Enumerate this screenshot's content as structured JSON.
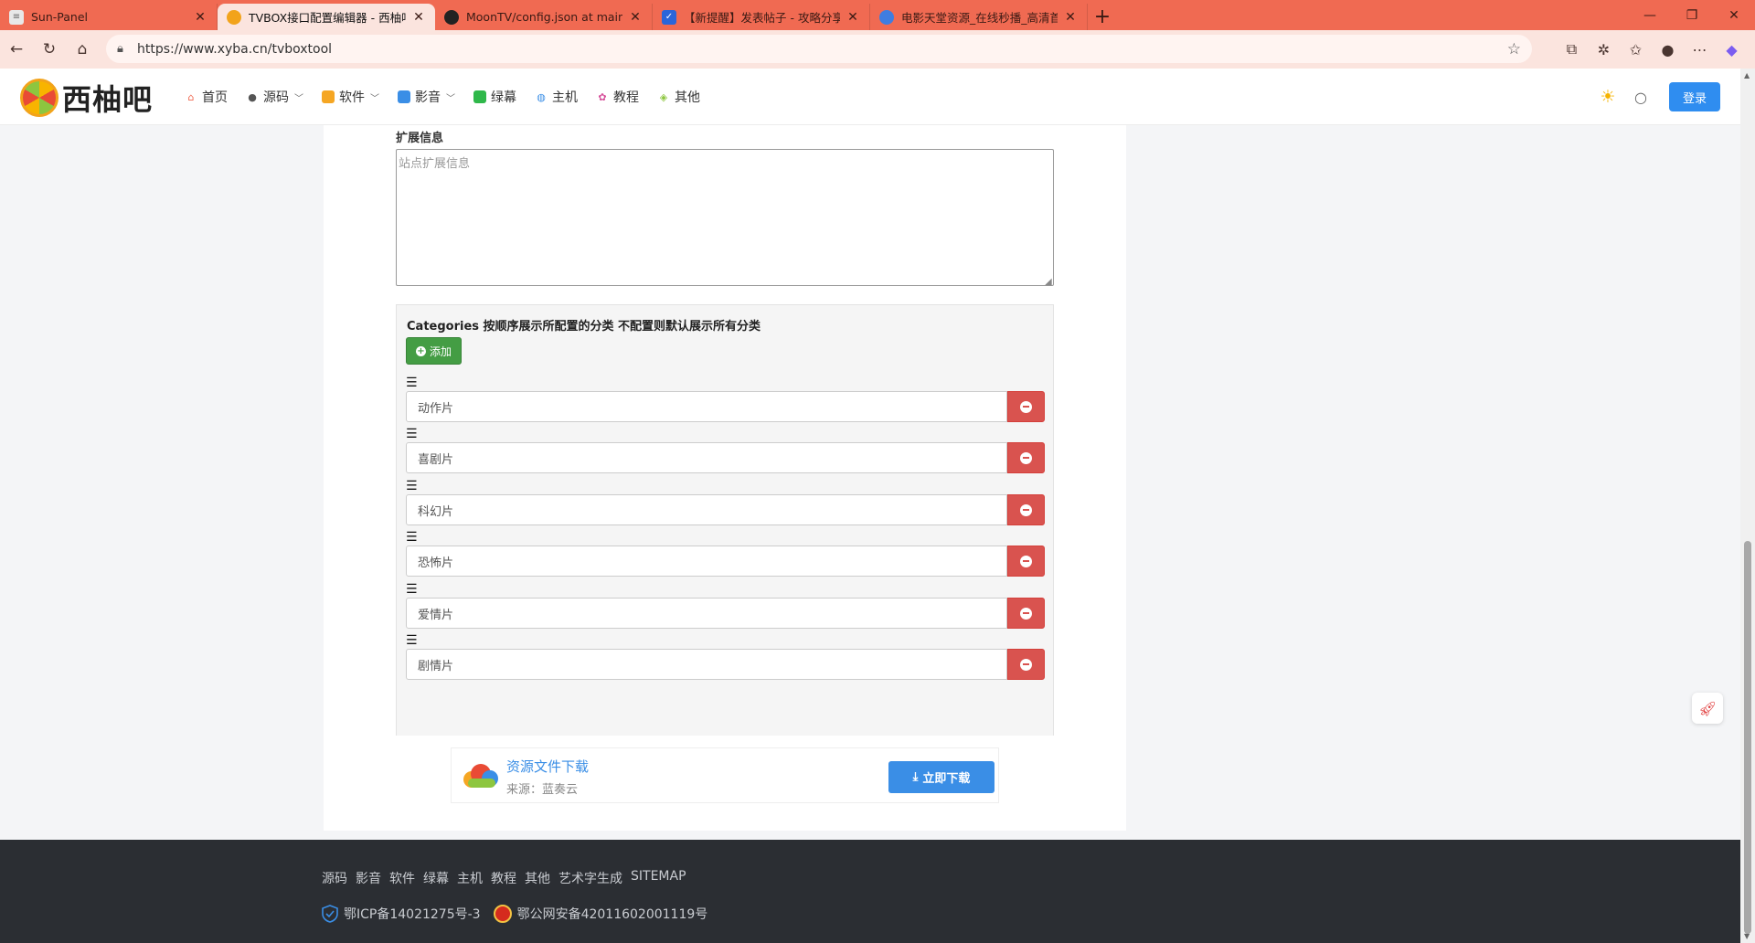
{
  "browser": {
    "tabs": [
      {
        "title": "Sun-Panel",
        "favicon_color": "#e8e8e8",
        "active": false
      },
      {
        "title": "TVBOX接口配置编辑器 - 西柚吧",
        "favicon_color": "#f2a31b",
        "active": true
      },
      {
        "title": "MoonTV/config.json at main · sar",
        "favicon_color": "#222222",
        "active": false
      },
      {
        "title": "【新提醒】发表帖子 - 攻略分享 ·",
        "favicon_color": "#2b65d9",
        "active": false
      },
      {
        "title": "电影天堂资源_在线秒播_高清首发",
        "favicon_color": "#3f7de0",
        "active": false
      }
    ],
    "url": "https://www.xyba.cn/tvboxtool"
  },
  "site": {
    "logo_text": "西柚吧",
    "nav": [
      {
        "label": "首页",
        "icon": "home-icon",
        "color": "#f06a52",
        "has_dropdown": false
      },
      {
        "label": "源码",
        "icon": "github-icon",
        "color": "#555555",
        "has_dropdown": true
      },
      {
        "label": "软件",
        "icon": "software-icon",
        "color": "#f5a623",
        "has_dropdown": true
      },
      {
        "label": "影音",
        "icon": "video-icon",
        "color": "#3a8ee6",
        "has_dropdown": true
      },
      {
        "label": "绿幕",
        "icon": "greenscreen-icon",
        "color": "#2fb84a",
        "has_dropdown": false
      },
      {
        "label": "主机",
        "icon": "globe-icon",
        "color": "#3a8ee6",
        "has_dropdown": false
      },
      {
        "label": "教程",
        "icon": "flower-icon",
        "color": "#d64f9a",
        "has_dropdown": false
      },
      {
        "label": "其他",
        "icon": "layers-icon",
        "color": "#8dc63f",
        "has_dropdown": false
      }
    ],
    "login_label": "登录"
  },
  "form": {
    "ext_label": "扩展信息",
    "ext_placeholder": "站点扩展信息",
    "categories_title": "Categories 按顺序展示所配置的分类 不配置则默认展示所有分类",
    "add_label": "添加",
    "categories": [
      "动作片",
      "喜剧片",
      "科幻片",
      "恐怖片",
      "爱情片",
      "剧情片"
    ]
  },
  "download": {
    "title": "资源文件下载",
    "source": "来源：蓝奏云",
    "button": "立即下载"
  },
  "footer": {
    "links": [
      "源码",
      "影音",
      "软件",
      "绿幕",
      "主机",
      "教程",
      "其他",
      "艺术字生成",
      "SITEMAP"
    ],
    "icp": "鄂ICP备14021275号-3",
    "police": "鄂公网安备42011602001119号"
  },
  "colors": {
    "tabbar": "#f06a52",
    "primary_blue": "#2f8df0",
    "add_green": "#449d44",
    "remove_red": "#d9534f",
    "footer_bg": "#2b2e33"
  }
}
